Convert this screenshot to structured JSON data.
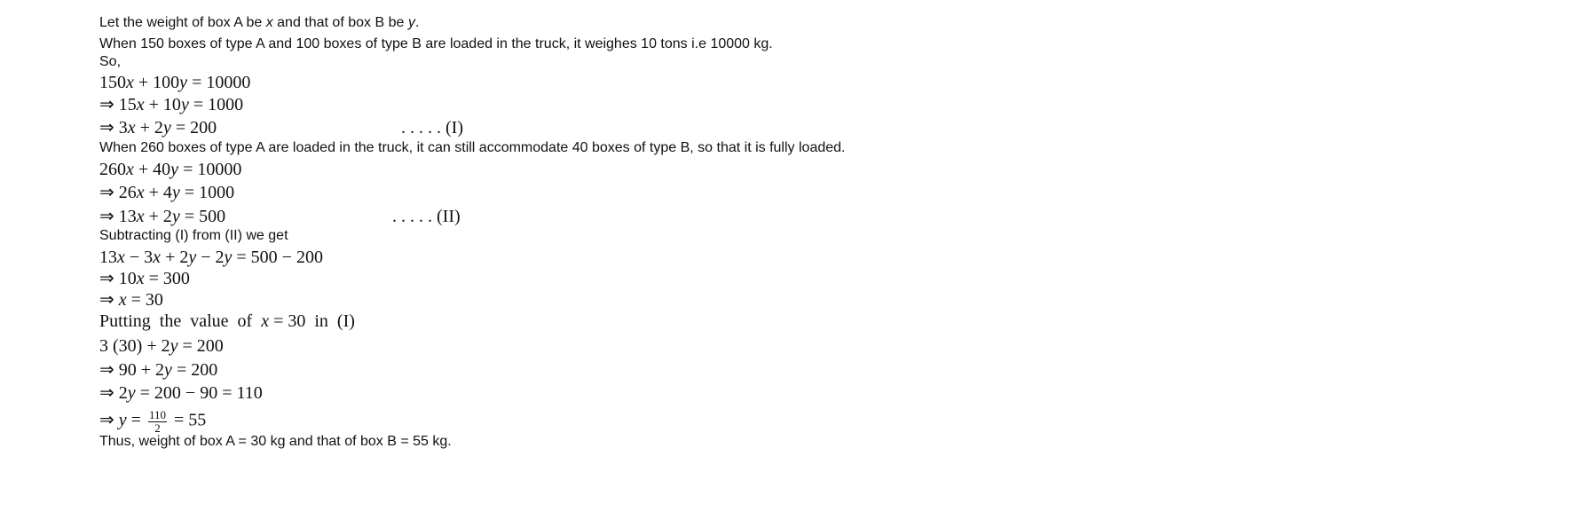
{
  "lines": [
    {
      "kind": "txt",
      "segs": [
        [
          "Let the weight of box A be ",
          0
        ],
        [
          "x",
          1
        ],
        [
          " and that of box B be ",
          0
        ],
        [
          "y",
          1
        ],
        [
          ".",
          0
        ]
      ]
    },
    {
      "kind": "txt",
      "segs": [
        [
          "When 150 boxes of type A and 100 boxes of type B are loaded in the truck, it weighes 10 tons i.e 10000 kg.",
          0
        ]
      ]
    },
    {
      "kind": "txt",
      "segs": [
        [
          "So,",
          0
        ]
      ]
    },
    {
      "kind": "math",
      "segs": [
        [
          "150",
          0
        ],
        [
          "x",
          1
        ],
        [
          " + 100",
          0
        ],
        [
          "y",
          1
        ],
        [
          " = 10000",
          0
        ]
      ]
    },
    {
      "kind": "math",
      "segs": [
        [
          "⇒ 15",
          0
        ],
        [
          "x",
          1
        ],
        [
          " + 10",
          0
        ],
        [
          "y",
          1
        ],
        [
          " = 1000",
          0
        ]
      ]
    },
    {
      "kind": "math",
      "segs": [
        [
          "⇒ 3",
          0
        ],
        [
          "x",
          1
        ],
        [
          " + 2",
          0
        ],
        [
          "y",
          1
        ],
        [
          " = 200",
          0
        ]
      ],
      "tag": ". . . . . (I)",
      "tagx": 340
    },
    {
      "kind": "txt",
      "segs": [
        [
          "When 260 boxes of type A are loaded in the truck, it can still accommodate 40 boxes of type B, so that it is fully loaded.",
          0
        ]
      ]
    },
    {
      "kind": "math",
      "segs": [
        [
          "260",
          0
        ],
        [
          "x",
          1
        ],
        [
          " + 40",
          0
        ],
        [
          "y",
          1
        ],
        [
          " = 10000",
          0
        ]
      ]
    },
    {
      "kind": "math",
      "segs": [
        [
          "⇒ 26",
          0
        ],
        [
          "x",
          1
        ],
        [
          " + 4",
          0
        ],
        [
          "y",
          1
        ],
        [
          " = 1000",
          0
        ]
      ]
    },
    {
      "kind": "math",
      "segs": [
        [
          "⇒ 13",
          0
        ],
        [
          "x",
          1
        ],
        [
          " + 2",
          0
        ],
        [
          "y",
          1
        ],
        [
          " = 500",
          0
        ]
      ],
      "tag": ". . . . . (II)",
      "tagx": 330
    },
    {
      "kind": "txt",
      "segs": [
        [
          "Subtracting (I) from (II) we get",
          0
        ]
      ]
    },
    {
      "kind": "math",
      "segs": [
        [
          "13",
          0
        ],
        [
          "x",
          1
        ],
        [
          " − 3",
          0
        ],
        [
          "x",
          1
        ],
        [
          " + 2",
          0
        ],
        [
          "y",
          1
        ],
        [
          " − 2",
          0
        ],
        [
          "y",
          1
        ],
        [
          " = 500 − 200",
          0
        ]
      ]
    },
    {
      "kind": "math",
      "segs": [
        [
          "⇒ 10",
          0
        ],
        [
          "x",
          1
        ],
        [
          " = 300",
          0
        ]
      ]
    },
    {
      "kind": "math",
      "segs": [
        [
          "⇒ ",
          0
        ],
        [
          "x",
          1
        ],
        [
          " = 30",
          0
        ]
      ]
    },
    {
      "kind": "math",
      "segs": [
        [
          "Putting  the  value  of  ",
          0
        ],
        [
          "x",
          1
        ],
        [
          " = 30  in  (I)",
          0
        ]
      ]
    },
    {
      "kind": "math",
      "segs": [
        [
          "3 (30) + 2",
          0
        ],
        [
          "y",
          1
        ],
        [
          " = 200",
          0
        ]
      ]
    },
    {
      "kind": "math",
      "segs": [
        [
          "⇒ 90 + 2",
          0
        ],
        [
          "y",
          1
        ],
        [
          " = 200",
          0
        ]
      ]
    },
    {
      "kind": "math",
      "segs": [
        [
          "⇒ 2",
          0
        ],
        [
          "y",
          1
        ],
        [
          " = 200 − 90 = 110",
          0
        ]
      ]
    },
    {
      "kind": "math",
      "segs": [
        [
          "⇒ ",
          0
        ],
        [
          "y",
          1
        ],
        [
          " = ",
          0
        ],
        [
          "110|2",
          2
        ],
        [
          " = 55",
          0
        ]
      ]
    },
    {
      "kind": "txt",
      "segs": [
        [
          "Thus, weight of box A = 30 kg and that of box B = 55 kg.",
          0
        ]
      ]
    }
  ]
}
